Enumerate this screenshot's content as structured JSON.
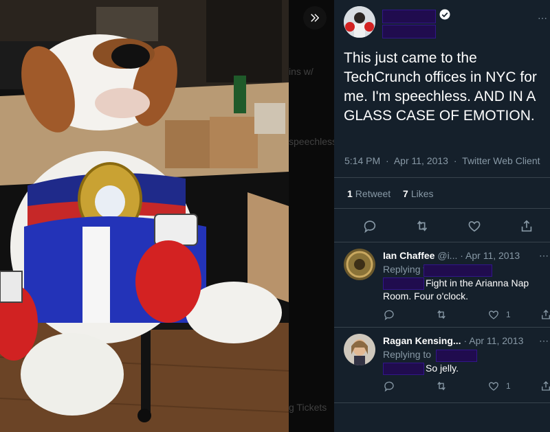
{
  "photo": {
    "ghost_text_1": "ins w/",
    "ghost_text_2": "speechless",
    "ghost_text_3": "g Tickets",
    "expand_icon": "double-chevron-right-icon"
  },
  "tweet": {
    "text": "This just came to the TechCrunch offices in NYC for me. I'm speechless. AND IN A GLASS CASE OF EMOTION.",
    "time": "5:14 PM",
    "date": "Apr 11, 2013",
    "client": "Twitter Web Client",
    "retweet_count": "1",
    "retweet_label": "Retweet",
    "like_count": "7",
    "like_label": "Likes",
    "more_label": "⋯"
  },
  "replies": [
    {
      "name": "Ian Chaffee",
      "handle": "@i...",
      "date": "· Apr 11, 2013",
      "replying_to": "Replying to",
      "text": "Fight in the Arianna Nap Room. Four o'clock.",
      "like_count": "1",
      "more": "⋯"
    },
    {
      "name": "Ragan Kensing...",
      "handle": "",
      "date": "· Apr 11, 2013",
      "replying_to": "Replying to",
      "text": "So jelly.",
      "like_count": "1",
      "more": "⋯"
    }
  ],
  "colors": {
    "panel_bg": "#15202b",
    "muted_text": "#8899a6",
    "divider": "#38444d",
    "redaction": "#200c4e"
  }
}
